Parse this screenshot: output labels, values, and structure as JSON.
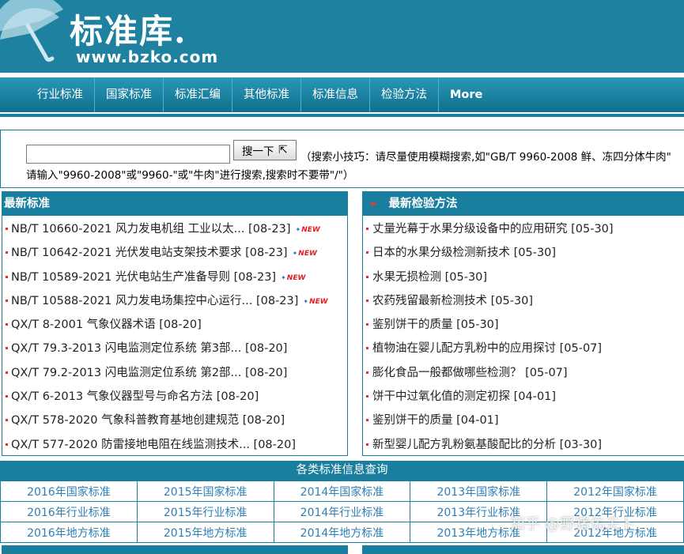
{
  "header": {
    "title": "标准库.",
    "url": "www.bzko.com"
  },
  "nav": {
    "items": [
      "行业标准",
      "国家标准",
      "标准汇编",
      "其他标准",
      "标准信息",
      "检验方法",
      "More"
    ]
  },
  "search": {
    "input_value": "",
    "button_label": "搜一下",
    "tips_line1": "（搜索小技巧：请尽量使用模糊搜索,如\"GB/T 9960-2008 鲜、冻四分体牛肉\"",
    "tips_line2": "请输入\"9960-2008\"或\"9960-\"或\"牛肉\"进行搜索,搜索时不要带\"/\"）"
  },
  "latest_standards": {
    "title": "最新标准",
    "items": [
      {
        "text": "NB/T 10660-2021 风力发电机组 工业以太... [08-23]",
        "new": true
      },
      {
        "text": "NB/T 10642-2021 光伏发电站支架技术要求 [08-23]",
        "new": true
      },
      {
        "text": "NB/T 10589-2021 光伏电站生产准备导则 [08-23]",
        "new": true
      },
      {
        "text": "NB/T 10588-2021 风力发电场集控中心运行... [08-23]",
        "new": true
      },
      {
        "text": "QX/T 8-2001 气象仪器术语 [08-20]",
        "new": false
      },
      {
        "text": "QX/T 79.3-2013 闪电监测定位系统 第3部... [08-20]",
        "new": false
      },
      {
        "text": "QX/T 79.2-2013 闪电监测定位系统 第2部... [08-20]",
        "new": false
      },
      {
        "text": "QX/T 6-2013 气象仪器型号与命名方法 [08-20]",
        "new": false
      },
      {
        "text": "QX/T 578-2020 气象科普教育基地创建规范 [08-20]",
        "new": false
      },
      {
        "text": "QX/T 577-2020 防雷接地电阻在线监测技术... [08-20]",
        "new": false
      }
    ],
    "new_badge": "NEW"
  },
  "latest_methods": {
    "title": "最新检验方法",
    "items": [
      "丈量光幕于水果分级设备中的应用研究 [05-30]",
      "日本的水果分级检测新技术 [05-30]",
      "水果无损检测 [05-30]",
      "农药残留最新检测技术 [05-30]",
      "鉴别饼干的质量 [05-30]",
      "植物油在婴儿配方乳粉中的应用探讨 [05-07]",
      "膨化食品一般都做哪些检测？ [05-07]",
      "饼干中过氧化值的测定初探 [04-01]",
      "鉴别饼干的质量 [04-01]",
      "新型婴儿配方乳粉氨基酸配比的分析 [03-30]"
    ]
  },
  "categories": {
    "title": "各类标准信息查询",
    "rows": [
      [
        "2016年国家标准",
        "2015年国家标准",
        "2014年国家标准",
        "2013年国家标准",
        "2012年国家标准"
      ],
      [
        "2016年行业标准",
        "2015年行业标准",
        "2014年行业标准",
        "2013年行业标准",
        "2012年行业标准"
      ],
      [
        "2016年地方标准",
        "2015年地方标准",
        "2014年地方标准",
        "2013年地方标准",
        "2012年地方标准"
      ]
    ]
  },
  "watermark": "知乎 @野猪佑夫卜",
  "colors": {
    "header_bg": "#1d819f",
    "nav_bg": "#1a7f9e",
    "link": "#2e7fb4",
    "bullet": "#e0312f"
  }
}
